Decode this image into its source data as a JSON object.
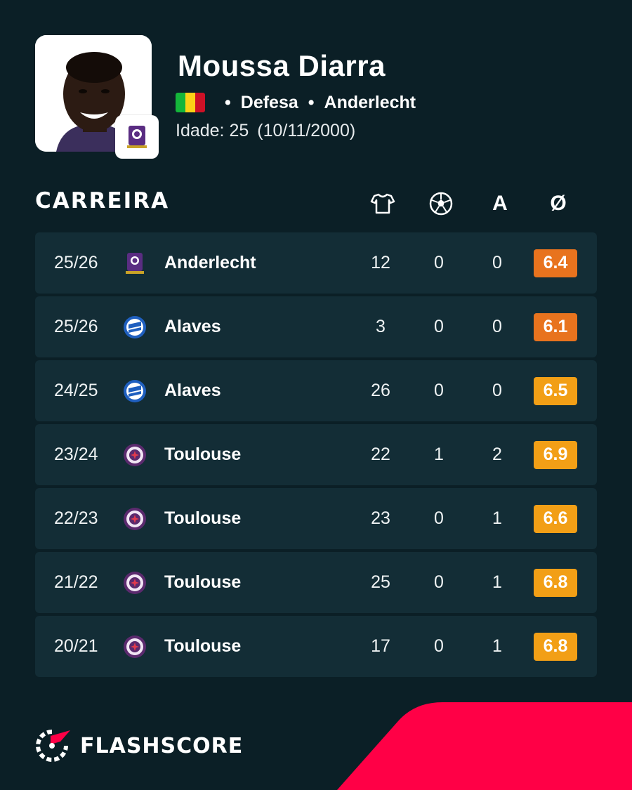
{
  "player": {
    "name": "Moussa Diarra",
    "flag_colors": [
      "#14b53a",
      "#fcd116",
      "#ce1126"
    ],
    "position": "Defesa",
    "club": "Anderlecht",
    "age_label": "Idade: 25",
    "birthdate": "(10/11/2000)"
  },
  "career": {
    "title": "CARREIRA",
    "columns": {
      "apps_icon": "shirt-icon",
      "goals_icon": "ball-icon",
      "assists": "A",
      "rating": "Ø"
    },
    "rows": [
      {
        "season": "25/26",
        "team": "Anderlecht",
        "crest": "anderlecht",
        "apps": "12",
        "goals": "0",
        "assists": "0",
        "rating": "6.4",
        "rating_color": "#e8731e"
      },
      {
        "season": "25/26",
        "team": "Alaves",
        "crest": "alaves",
        "apps": "3",
        "goals": "0",
        "assists": "0",
        "rating": "6.1",
        "rating_color": "#e8731e"
      },
      {
        "season": "24/25",
        "team": "Alaves",
        "crest": "alaves",
        "apps": "26",
        "goals": "0",
        "assists": "0",
        "rating": "6.5",
        "rating_color": "#f29f16"
      },
      {
        "season": "23/24",
        "team": "Toulouse",
        "crest": "toulouse",
        "apps": "22",
        "goals": "1",
        "assists": "2",
        "rating": "6.9",
        "rating_color": "#f29f16"
      },
      {
        "season": "22/23",
        "team": "Toulouse",
        "crest": "toulouse",
        "apps": "23",
        "goals": "0",
        "assists": "1",
        "rating": "6.6",
        "rating_color": "#f29f16"
      },
      {
        "season": "21/22",
        "team": "Toulouse",
        "crest": "toulouse",
        "apps": "25",
        "goals": "0",
        "assists": "1",
        "rating": "6.8",
        "rating_color": "#f29f16"
      },
      {
        "season": "20/21",
        "team": "Toulouse",
        "crest": "toulouse",
        "apps": "17",
        "goals": "0",
        "assists": "1",
        "rating": "6.8",
        "rating_color": "#f29f16"
      }
    ]
  },
  "brand": {
    "name": "FLASHSCORE",
    "accent": "#ff0046",
    "background": "#0b1f26",
    "row_background": "#132d36"
  }
}
